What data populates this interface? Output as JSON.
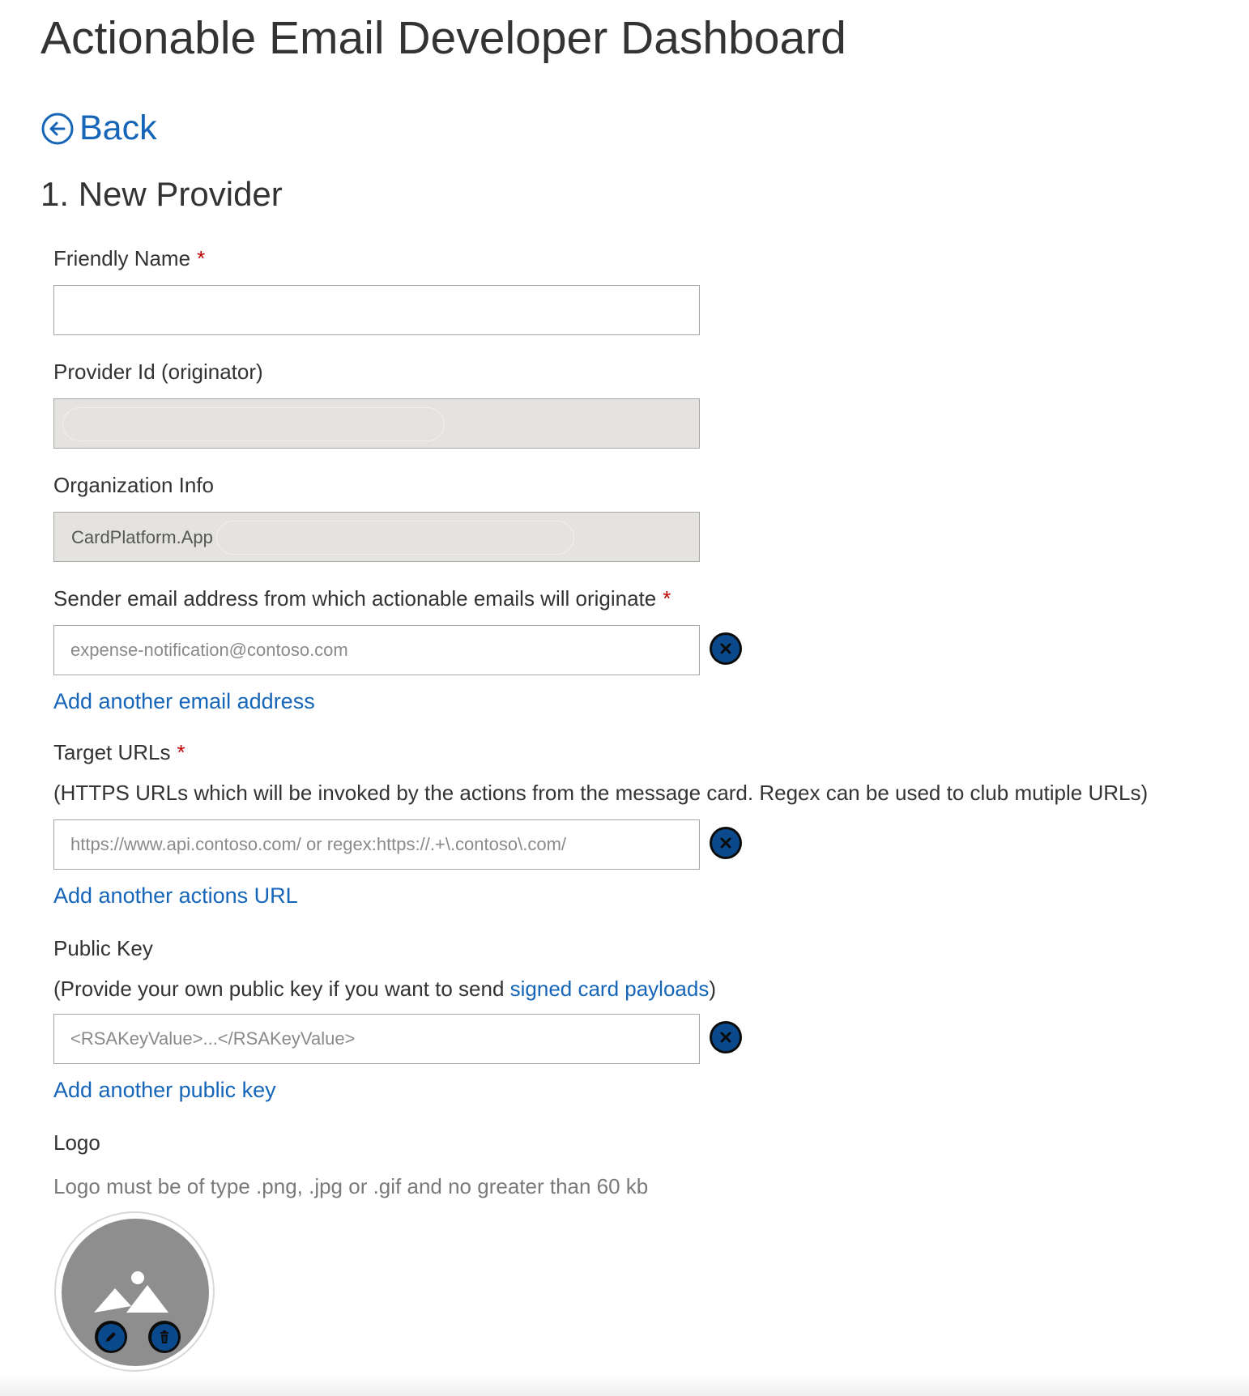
{
  "header": {
    "title": "Actionable Email Developer Dashboard"
  },
  "nav": {
    "back_label": "Back",
    "back_icon": "circle-arrow-left-icon"
  },
  "section": {
    "title": "1. New Provider"
  },
  "form": {
    "required_marker": "*",
    "friendly_name": {
      "label": "Friendly Name",
      "required": true,
      "value": ""
    },
    "provider_id": {
      "label": "Provider Id (originator)",
      "value": ""
    },
    "organization_info": {
      "label": "Organization Info",
      "value": "CardPlatform.App"
    },
    "sender_email": {
      "label": "Sender email address from which actionable emails will originate",
      "required": true,
      "placeholder": "expense-notification@contoso.com",
      "add_label": "Add another email address"
    },
    "target_urls": {
      "label": "Target URLs",
      "required": true,
      "helper": "(HTTPS URLs which will be invoked by the actions from the message card. Regex can be used to club mutiple URLs)",
      "placeholder": "https://www.api.contoso.com/ or regex:https://.+\\.contoso\\.com/",
      "add_label": "Add another actions URL"
    },
    "public_key": {
      "label": "Public Key",
      "helper_prefix": "(Provide your own public key if you want to send ",
      "helper_link": "signed card payloads",
      "helper_suffix": ")",
      "placeholder": "<RSAKeyValue>...</RSAKeyValue>",
      "add_label": "Add another public key"
    },
    "logo": {
      "label": "Logo",
      "hint": "Logo must be of type .png, .jpg or .gif and no greater than 60 kb",
      "placeholder_icon": "image-placeholder-icon",
      "edit_icon": "pencil-icon",
      "delete_icon": "trash-icon"
    }
  },
  "colors": {
    "link": "#1565b8",
    "required": "#c00000",
    "readonly_bg": "#e4e3df",
    "icon_button": "#0a4a8c"
  }
}
